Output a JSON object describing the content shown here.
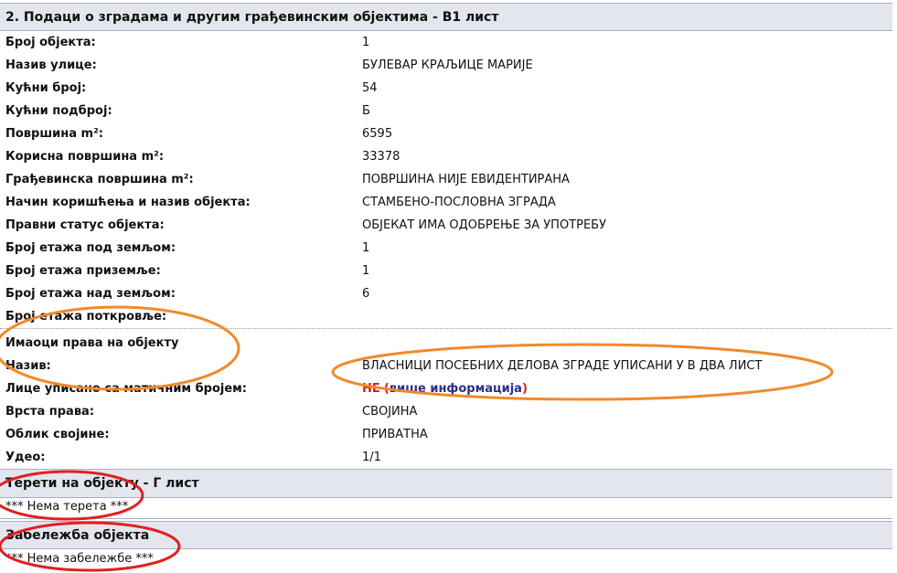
{
  "building_section": {
    "title": "2. Подаци о зградама и другим грађевинским објектима - В1 лист",
    "rows": [
      {
        "label": "Број објекта:",
        "value": "1"
      },
      {
        "label": "Назив улице:",
        "value": "БУЛЕВАР КРАЉИЦЕ МАРИЈЕ"
      },
      {
        "label": "Кућни број:",
        "value": "54"
      },
      {
        "label": "Кућни подброј:",
        "value": "Б"
      },
      {
        "label": "Површина m²:",
        "value": "6595"
      },
      {
        "label": "Корисна површина m²:",
        "value": "33378"
      },
      {
        "label": "Грађевинска површина m²:",
        "value": "ПОВРШИНА НИЈЕ ЕВИДЕНТИРАНА"
      },
      {
        "label": "Начин коришћења и назив објекта:",
        "value": "СТАМБЕНО-ПОСЛОВНА ЗГРАДА"
      },
      {
        "label": "Правни статус објекта:",
        "value": "ОБЈЕКАТ ИМА ОДОБРЕЊЕ ЗА УПОТРЕБУ"
      },
      {
        "label": "Број етажа под земљом:",
        "value": "1"
      },
      {
        "label": "Број етажа приземље:",
        "value": "1"
      },
      {
        "label": "Број етажа над земљом:",
        "value": "6"
      },
      {
        "label": "Број етажа поткровље:",
        "value": ""
      }
    ]
  },
  "owners": {
    "title": "Имаоци права на објекту",
    "name_label": "Назив:",
    "name_value": "ВЛАСНИЦИ ПОСЕБНИХ ДЕЛОВА ЗГРАДЕ УПИСАНИ У В ДВА ЛИСТ",
    "person_label": "Лице уписано са матичним бројем:",
    "person_value": "НЕ",
    "more_info_link": "више информација",
    "paren_open": "(",
    "paren_close": ")",
    "right_type_label": "Врста права:",
    "right_type_value": "СВОЈИНА",
    "ownership_form_label": "Облик својине:",
    "ownership_form_value": "ПРИВАТНА",
    "share_label": "Удео:",
    "share_value": "1/1"
  },
  "encumbrances": {
    "title": "Терети на објекту - Г лист",
    "empty_text": "*** Нема терета ***"
  },
  "notes": {
    "title": "Забележба објекта",
    "empty_text": "*** Нема забележбе ***"
  },
  "annotation_colors": {
    "orange": "#f08a2c",
    "red": "#e02020"
  }
}
